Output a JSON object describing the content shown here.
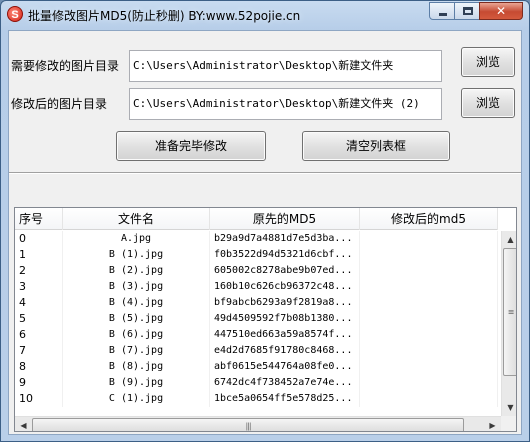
{
  "window": {
    "title": "批量修改图片MD5(防止秒删) BY:www.52pojie.cn",
    "app_icon_glyph": "S",
    "minimize_glyph": "",
    "maximize_glyph": "",
    "close_glyph": "✕"
  },
  "form": {
    "source_dir_label": "需要修改的图片目录",
    "source_dir_value": "C:\\Users\\Administrator\\Desktop\\新建文件夹",
    "source_browse_label": "浏览",
    "output_dir_label": "修改后的图片目录",
    "output_dir_value": "C:\\Users\\Administrator\\Desktop\\新建文件夹 (2)",
    "output_browse_label": "浏览",
    "start_button_label": "准备完毕修改",
    "clear_button_label": "清空列表框"
  },
  "table": {
    "columns": [
      "序号",
      "文件名",
      "原先的MD5",
      "修改后的md5"
    ],
    "rows": [
      {
        "index": "0",
        "filename": "A.jpg",
        "original_md5": "b29a9d7a4881d7e5d3ba...",
        "new_md5": ""
      },
      {
        "index": "1",
        "filename": "B (1).jpg",
        "original_md5": "f0b3522d94d5321d6cbf...",
        "new_md5": ""
      },
      {
        "index": "2",
        "filename": "B (2).jpg",
        "original_md5": "605002c8278abe9b07ed...",
        "new_md5": ""
      },
      {
        "index": "3",
        "filename": "B (3).jpg",
        "original_md5": "160b10c626cb96372c48...",
        "new_md5": ""
      },
      {
        "index": "4",
        "filename": "B (4).jpg",
        "original_md5": "bf9abcb6293a9f2819a8...",
        "new_md5": ""
      },
      {
        "index": "5",
        "filename": "B (5).jpg",
        "original_md5": "49d4509592f7b08b1380...",
        "new_md5": ""
      },
      {
        "index": "6",
        "filename": "B (6).jpg",
        "original_md5": "447510ed663a59a8574f...",
        "new_md5": ""
      },
      {
        "index": "7",
        "filename": "B (7).jpg",
        "original_md5": "e4d2d7685f91780c8468...",
        "new_md5": ""
      },
      {
        "index": "8",
        "filename": "B (8).jpg",
        "original_md5": "abf0615e544764a08fe0...",
        "new_md5": ""
      },
      {
        "index": "9",
        "filename": "B (9).jpg",
        "original_md5": "6742dc4f738452a7e74e...",
        "new_md5": ""
      },
      {
        "index": "10",
        "filename": "C (1).jpg",
        "original_md5": "1bce5a0654ff5e578d25...",
        "new_md5": ""
      }
    ]
  },
  "scrollbars": {
    "up_glyph": "▲",
    "down_glyph": "▼",
    "left_glyph": "◀",
    "right_glyph": "▶",
    "grip_glyph": "≡",
    "grip_h_glyph": "|||"
  }
}
